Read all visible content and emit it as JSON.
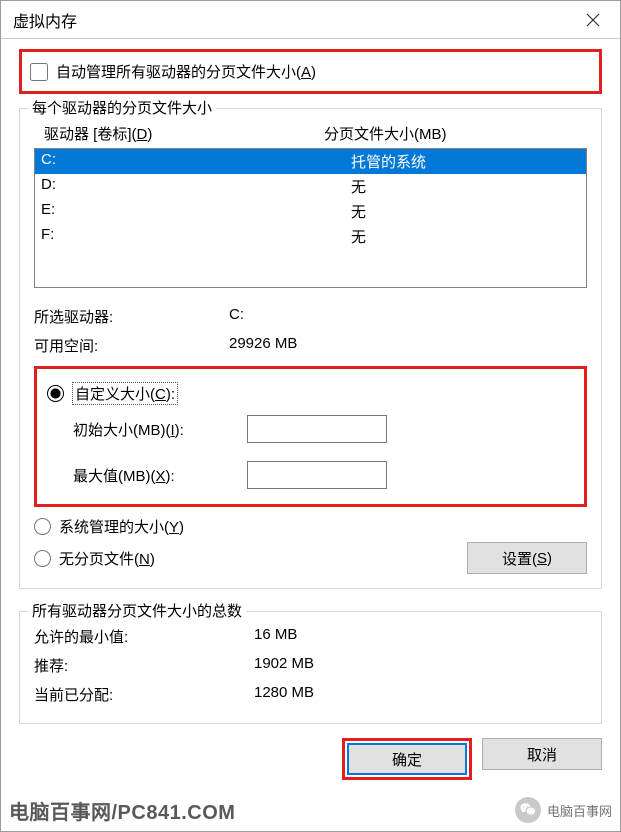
{
  "window": {
    "title": "虚拟内存"
  },
  "auto_manage": {
    "checked": false,
    "label_pre": "自动管理所有驱动器的分页文件大小(",
    "label_mn": "A",
    "label_post": ")"
  },
  "group1": {
    "legend": "每个驱动器的分页文件大小",
    "header_drive_pre": "驱动器 [卷标](",
    "header_drive_mn": "D",
    "header_drive_post": ")",
    "header_paging": "分页文件大小(MB)",
    "drives": [
      {
        "name": "C:",
        "paging": "托管的系统",
        "selected": true
      },
      {
        "name": "D:",
        "paging": "无",
        "selected": false
      },
      {
        "name": "E:",
        "paging": "无",
        "selected": false
      },
      {
        "name": "F:",
        "paging": "无",
        "selected": false
      }
    ],
    "selected_drive_label": "所选驱动器:",
    "selected_drive_value": "C:",
    "available_label": "可用空间:",
    "available_value": "29926 MB",
    "custom_pre": "自定义大小(",
    "custom_mn": "C",
    "custom_post": "):",
    "initial_pre": "初始大小(MB)(",
    "initial_mn": "I",
    "initial_post": "):",
    "initial_value": "",
    "max_pre": "最大值(MB)(",
    "max_mn": "X",
    "max_post": "):",
    "max_value": "",
    "sysmanaged_pre": "系统管理的大小(",
    "sysmanaged_mn": "Y",
    "sysmanaged_post": ")",
    "nopaging_pre": "无分页文件(",
    "nopaging_mn": "N",
    "nopaging_post": ")",
    "set_pre": "设置(",
    "set_mn": "S",
    "set_post": ")"
  },
  "group2": {
    "legend": "所有驱动器分页文件大小的总数",
    "min_label": "允许的最小值:",
    "min_value": "16 MB",
    "rec_label": "推荐:",
    "rec_value": "1902 MB",
    "cur_label": "当前已分配:",
    "cur_value": "1280 MB"
  },
  "buttons": {
    "ok": "确定",
    "cancel": "取消"
  },
  "watermark": {
    "left": "电脑百事网/PC841.COM",
    "right": "电脑百事网"
  }
}
